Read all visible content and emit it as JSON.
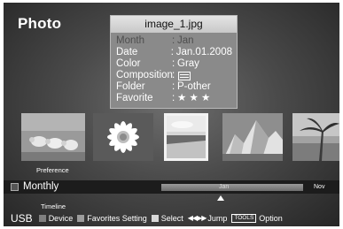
{
  "screen_title": "Photo",
  "info": {
    "filename": "image_1.jpg",
    "rows": [
      {
        "label": "Month",
        "sep": ":",
        "value": "Jan",
        "dim": true
      },
      {
        "label": "Date",
        "sep": ":",
        "value": "Jan.01.2008",
        "dim": false
      },
      {
        "label": "Color",
        "sep": ":",
        "value": "Gray",
        "dim": false
      },
      {
        "label": "Composition",
        "sep": ":",
        "value": "",
        "icon": "composition-lines-icon",
        "dim": false
      },
      {
        "label": "Folder",
        "sep": ":",
        "value": "P-other",
        "dim": false
      },
      {
        "label": "Favorite",
        "sep": ":",
        "value": "★ ★ ★",
        "dim": false
      }
    ]
  },
  "thumbnails": [
    {
      "name": "thumbnail-sheep",
      "selected": false
    },
    {
      "name": "thumbnail-flower",
      "selected": false
    },
    {
      "name": "thumbnail-beach",
      "selected": true
    },
    {
      "name": "thumbnail-mountain",
      "selected": false
    },
    {
      "name": "thumbnail-palm",
      "selected": false
    }
  ],
  "sort": {
    "above": "Preference",
    "current": "Monthly",
    "below": "Timeline"
  },
  "timeline": {
    "current_month": "Jan",
    "next_month": "Nov"
  },
  "footer": {
    "source": "USB",
    "items": [
      {
        "key": "device",
        "label": "Device",
        "color": "#7f7f7f"
      },
      {
        "key": "favorites",
        "label": "Favorites Setting",
        "color": "#9c9c9c"
      },
      {
        "key": "select",
        "label": "Select",
        "color": "#d8d8d8"
      },
      {
        "key": "jump",
        "label": "Jump",
        "icon": "rewind-fast-forward-icon"
      },
      {
        "key": "tools",
        "badge": "TOOLS",
        "label": "Option"
      }
    ]
  }
}
